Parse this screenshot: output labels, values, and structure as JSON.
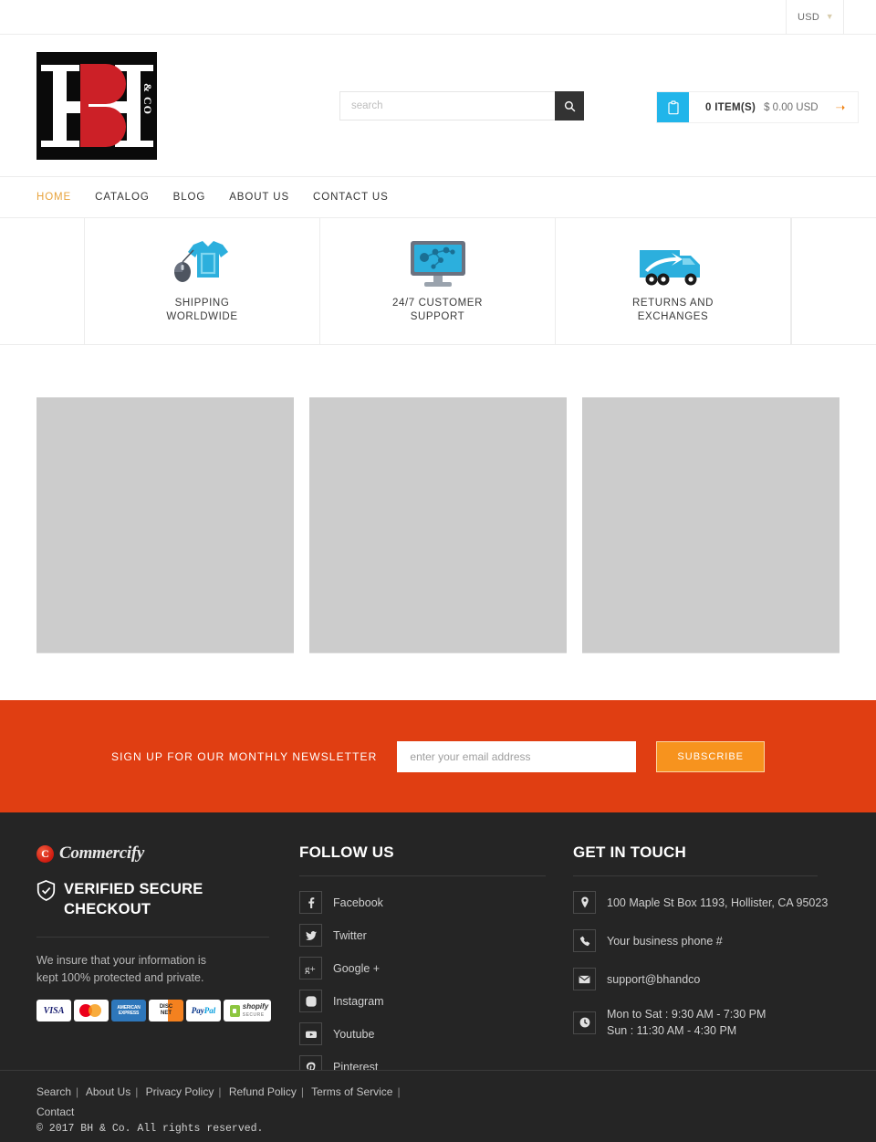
{
  "topbar": {
    "currency": "USD",
    "caret_icon": "chevron-down-icon"
  },
  "header": {
    "logo_initials": "BH",
    "logo_suffix": "& CO",
    "search": {
      "placeholder": "search",
      "value": "",
      "button_icon": "search-icon"
    },
    "cart": {
      "icon": "cart-icon",
      "count_label": "0 ITEM(S)",
      "total_label": "$ 0.00 USD",
      "arrow_icon": "arrow-right-icon",
      "icon_color": "#21b5ea",
      "arrow_color": "#f0861a"
    }
  },
  "nav": {
    "items": [
      {
        "label": "HOME",
        "active": true
      },
      {
        "label": "CATALOG",
        "active": false
      },
      {
        "label": "BLOG",
        "active": false
      },
      {
        "label": "ABOUT US",
        "active": false
      },
      {
        "label": "CONTACT US",
        "active": false
      }
    ],
    "active_color": "#e8a33d"
  },
  "features": [
    {
      "icon": "tshirt-mouse-icon",
      "line1": "SHIPPING",
      "line2": "WORLDWIDE"
    },
    {
      "icon": "monitor-network-icon",
      "line1": "24/7 CUSTOMER",
      "line2": "SUPPORT"
    },
    {
      "icon": "delivery-truck-icon",
      "line1": "RETURNS AND",
      "line2": "EXCHANGES"
    }
  ],
  "content_blocks": [
    {
      "name": "placeholder-block-1"
    },
    {
      "name": "placeholder-block-2"
    },
    {
      "name": "placeholder-block-3"
    }
  ],
  "newsletter": {
    "title": "SIGN UP FOR OUR MONTHLY NEWSLETTER",
    "placeholder": "enter your email address",
    "value": "",
    "button_label": "SUBSCRIBE",
    "background_color": "#e03e12",
    "button_color": "#f7931e"
  },
  "footer": {
    "brand": {
      "mark_letter": "C",
      "name": "Commercify",
      "verified_text": "VERIFIED SECURE CHECKOUT",
      "shield_icon": "shield-check-icon",
      "insure_line1": "We insure that your information is",
      "insure_line2": "kept 100% protected and private.",
      "payments": [
        {
          "name": "visa-badge",
          "label": "VISA"
        },
        {
          "name": "mastercard-badge",
          "label": ""
        },
        {
          "name": "amex-badge",
          "label": "AMERICAN EXPRESS"
        },
        {
          "name": "discover-badge",
          "label": "DISCOVER NETWORK"
        },
        {
          "name": "paypal-badge",
          "label": "PayPal"
        },
        {
          "name": "shopify-secure-badge",
          "label": "shopify SECURE"
        }
      ]
    },
    "follow": {
      "heading": "FOLLOW US",
      "items": [
        {
          "icon": "facebook-icon",
          "label": "Facebook"
        },
        {
          "icon": "twitter-icon",
          "label": "Twitter"
        },
        {
          "icon": "google-plus-icon",
          "label": "Google +"
        },
        {
          "icon": "instagram-icon",
          "label": "Instagram"
        },
        {
          "icon": "youtube-icon",
          "label": "Youtube"
        },
        {
          "icon": "pinterest-icon",
          "label": "Pinterest"
        }
      ]
    },
    "contact": {
      "heading": "GET IN TOUCH",
      "items": [
        {
          "icon": "location-pin-icon",
          "label": "100 Maple St Box 1193, Hollister, CA 95023"
        },
        {
          "icon": "phone-icon",
          "label": "Your business phone #"
        },
        {
          "icon": "envelope-icon",
          "label": "support@bhandco"
        },
        {
          "icon": "clock-icon",
          "label": "Mon to Sat : 9:30 AM - 7:30 PM",
          "label2": "Sun : 11:30 AM - 4:30 PM"
        }
      ]
    },
    "bottom": {
      "links": [
        "Search",
        "About Us",
        "Privacy Policy",
        "Refund Policy",
        "Terms of Service",
        "Contact"
      ],
      "copyright": "© 2017 BH & Co. All rights reserved."
    }
  }
}
